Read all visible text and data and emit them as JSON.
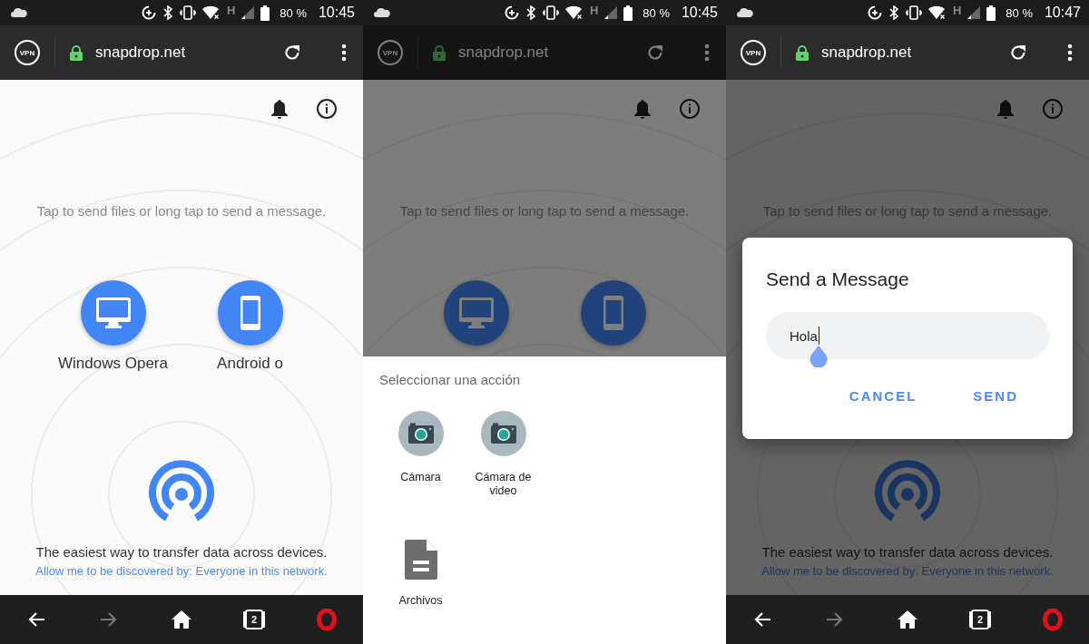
{
  "screens": [
    {
      "status_bar": {
        "network_type": "H",
        "battery": "80 %",
        "time": "10:45"
      },
      "browser_bar": {
        "vpn_label": "VPN",
        "url": "snapdrop.net"
      },
      "page": {
        "hint": "Tap to send files or long tap to send a message.",
        "devices": [
          {
            "kind": "desktop",
            "name": "Windows Opera"
          },
          {
            "kind": "phone",
            "name": "Android o"
          }
        ],
        "tagline": "The easiest way to transfer data across devices.",
        "discover_link": "Allow me to be discovered by: Everyone in this network."
      },
      "overlay": {
        "kind": "none"
      },
      "nav_bar": {
        "back": {
          "disabled": false
        },
        "forward": {
          "disabled": true
        },
        "tabs": {
          "count": "2"
        }
      }
    },
    {
      "status_bar": {
        "network_type": "H",
        "battery": "80 %",
        "time": "10:45"
      },
      "browser_bar": {
        "vpn_label": "VPN",
        "url": "snapdrop.net"
      },
      "page": {
        "hint": "Tap to send files or long tap to send a message.",
        "devices": [
          {
            "kind": "desktop"
          },
          {
            "kind": "phone"
          }
        ]
      },
      "overlay": {
        "kind": "sheet",
        "title": "Seleccionar una acción",
        "actions": [
          {
            "kind": "camera",
            "label": "Cámara"
          },
          {
            "kind": "camera",
            "label": "Cámara de video"
          },
          {
            "kind": "file",
            "label": "Archivos"
          }
        ]
      }
    },
    {
      "status_bar": {
        "network_type": "H",
        "battery": "80 %",
        "time": "10:47"
      },
      "browser_bar": {
        "vpn_label": "VPN",
        "url": "snapdrop.net"
      },
      "page": {
        "hint": "Tap to send files or long tap to send a message.",
        "tagline": "The easiest way to transfer data across devices.",
        "discover_link": "Allow me to be discovered by: Everyone in this network."
      },
      "overlay": {
        "kind": "dialog",
        "title": "Send a Message",
        "input_value": "Hola",
        "buttons": [
          "CANCEL",
          "SEND"
        ]
      },
      "nav_bar": {
        "back": {
          "disabled": false
        },
        "forward": {
          "disabled": true
        },
        "tabs": {
          "count": "2"
        }
      }
    }
  ]
}
